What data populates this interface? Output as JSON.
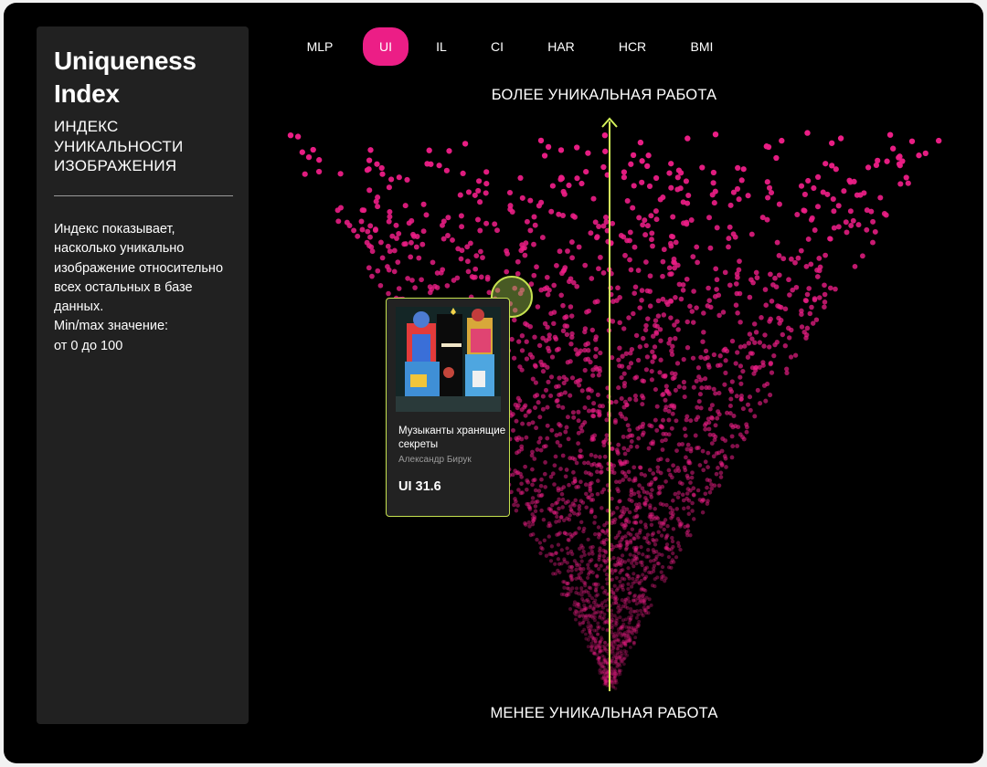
{
  "sidebar": {
    "title": "Uniqueness Index",
    "subtitle": "ИНДЕКС УНИКАЛЬНОСТИ ИЗОБРАЖЕНИЯ",
    "description": "Индекс показывает, насколько уникально изображение относительно всех остальных в базе данных.\nMin/max значение:\nот 0 до 100"
  },
  "tabs": [
    {
      "label": "MLP",
      "active": false
    },
    {
      "label": "UI",
      "active": true
    },
    {
      "label": "IL",
      "active": false
    },
    {
      "label": "CI",
      "active": false
    },
    {
      "label": "HAR",
      "active": false
    },
    {
      "label": "HCR",
      "active": false
    },
    {
      "label": "BMI",
      "active": false
    }
  ],
  "axis": {
    "top_label": "БОЛЕЕ УНИКАЛЬНАЯ РАБОТА",
    "bottom_label": "МЕНЕЕ УНИКАЛЬНАЯ РАБОТА"
  },
  "selected_card": {
    "title": "Музыканты хранящие секреты",
    "artist": "Александр Бирук",
    "score": "UI 31.6"
  },
  "colors": {
    "accent": "#ec1e86",
    "highlight": "#c6e24f",
    "arrow": "#d4f25a",
    "panel": "#212121"
  }
}
